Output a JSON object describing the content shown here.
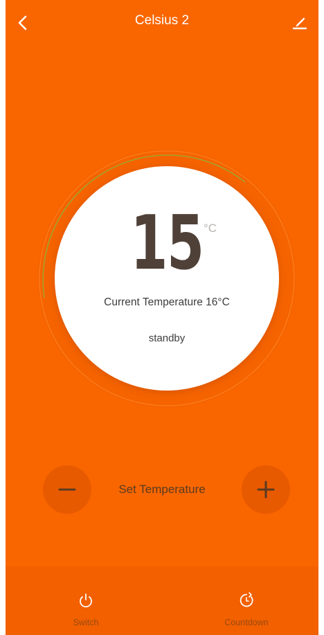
{
  "header": {
    "title": "Celsius 2",
    "back_icon": "chevron-left-icon",
    "edit_icon": "pencil-icon"
  },
  "dial": {
    "set_temperature": "15",
    "unit": "°C",
    "current_temperature": "Current Temperature 16°C",
    "status": "standby"
  },
  "controls": {
    "label": "Set Temperature",
    "minus_icon": "minus-icon",
    "plus_icon": "plus-icon"
  },
  "bottom_bar": {
    "switch_label": "Switch",
    "countdown_label": "Countdown",
    "switch_icon": "power-icon",
    "countdown_icon": "timer-icon"
  },
  "colors": {
    "background": "#f96600",
    "bottom_bar": "#f26000",
    "button_fill": "#e85a00",
    "dial_accent": "#8fb33a"
  }
}
